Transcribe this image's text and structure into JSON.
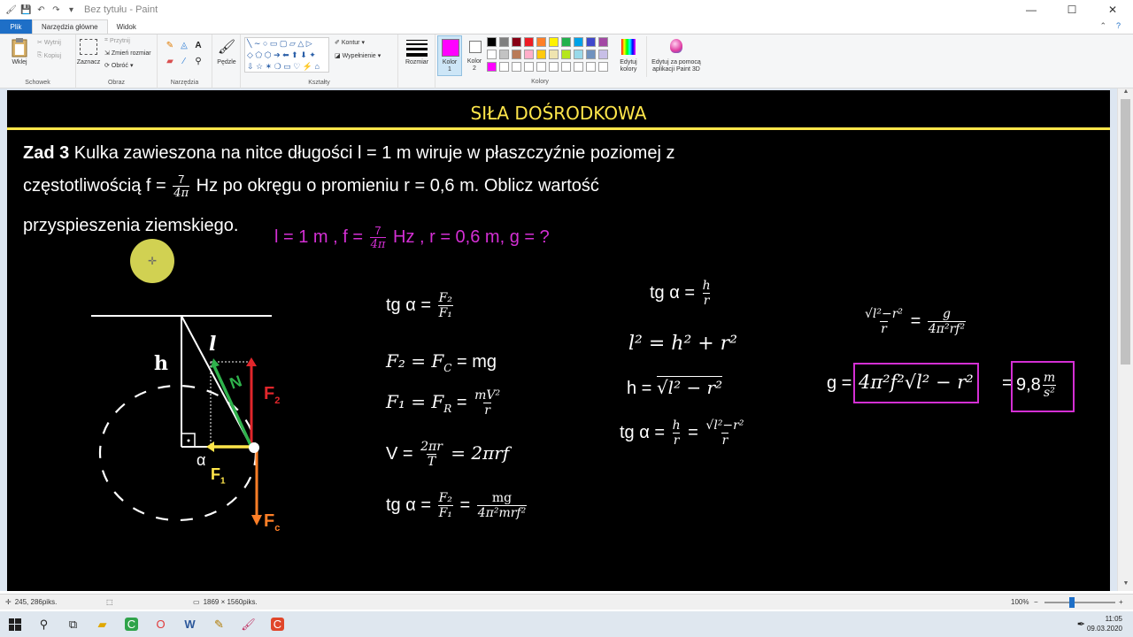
{
  "titlebar": {
    "title": "Bez tytułu - Paint",
    "minimize": "—",
    "maximize": "☐",
    "close": "✕"
  },
  "tabs": {
    "file": "Plik",
    "home": "Narzędzia główne",
    "view": "Widok",
    "help": "?"
  },
  "ribbon": {
    "clipboard": {
      "paste": "Wklej",
      "cut": "Wytnij",
      "copy": "Kopiuj",
      "label": "Schowek"
    },
    "image": {
      "select": "Zaznacz",
      "crop": "Przytnij",
      "resize": "Zmień rozmiar",
      "rotate": "Obróć",
      "label": "Obraz"
    },
    "tools": {
      "label": "Narzędzia"
    },
    "brushes": {
      "label": "Pędzle"
    },
    "shapes": {
      "outline": "Kontur",
      "fill": "Wypełnienie",
      "label": "Kształty"
    },
    "size": {
      "label": "Rozmiar"
    },
    "color1": {
      "label1": "Kolor",
      "label2": "1",
      "value": "#ff00ff"
    },
    "color2": {
      "label1": "Kolor",
      "label2": "2",
      "value": "#ffffff"
    },
    "colors": {
      "label": "Kolory",
      "palette": [
        "#000000",
        "#7f7f7f",
        "#880015",
        "#ed1c24",
        "#ff7f27",
        "#fff200",
        "#22b14c",
        "#00a2e8",
        "#3f48cc",
        "#a349a4",
        "#ffffff",
        "#c3c3c3",
        "#b97a57",
        "#ffaec9",
        "#ffc90e",
        "#efe4b0",
        "#b5e61d",
        "#99d9ea",
        "#7092be",
        "#c8bfe7",
        "#ff00ff",
        "#ffffff",
        "#ffffff",
        "#ffffff",
        "#ffffff",
        "#ffffff",
        "#ffffff",
        "#ffffff",
        "#ffffff",
        "#ffffff"
      ]
    },
    "edit_colors": {
      "line1": "Edytuj",
      "line2": "kolory"
    },
    "paint3d": {
      "line1": "Edytuj za pomocą",
      "line2": "aplikacji Paint 3D"
    }
  },
  "canvas": {
    "heading": "SIŁA DOŚRODKOWA",
    "heading_color": "#ffe64a",
    "task": {
      "label": "Zad 3",
      "line1": " Kulka zawieszona na nitce długości l = 1 m wiruje w płaszczyźnie poziomej z",
      "line2a": "częstotliwością f = ",
      "frac_num": "7",
      "frac_den": "4π",
      "line2b": " Hz po okręgu o promieniu r = 0,6 m. Oblicz wartość",
      "line3": "przyspieszenia ziemskiego."
    },
    "given": {
      "a": "l = 1 m , f = ",
      "frac_num": "7",
      "frac_den": "4π",
      "b": " Hz , r = 0,6 m, g = ?"
    },
    "diagram": {
      "h": "h",
      "l": "l",
      "alpha": "α",
      "N": "N",
      "F2": "F",
      "F2_sub": "2",
      "F1": "F",
      "F1_sub": "1",
      "Fc": "F",
      "Fc_sub": "c"
    },
    "col1": {
      "eq1_a": "tg α = ",
      "eq1_num": "F₂",
      "eq1_den": "F₁",
      "eq2": "F₂ = F",
      "eq2_sub": "C",
      "eq2_b": " = mg",
      "eq3": "F₁ = F",
      "eq3_sub": "R",
      "eq3_b": " = ",
      "eq3_num": "mV²",
      "eq3_den": "r",
      "eq4_a": "V = ",
      "eq4_num": "2πr",
      "eq4_den": "T",
      "eq4_b": " = 2πrf",
      "eq5_a": "tg α = ",
      "eq5_num": "F₂",
      "eq5_den": "F₁",
      "eq5_b": " = ",
      "eq5_num2": "mg",
      "eq5_den2": "4π²mrf²"
    },
    "col2": {
      "eq1_a": "tg α = ",
      "eq1_num": "h",
      "eq1_den": "r",
      "eq2": "l² = h² + r²",
      "eq3_a": "h = ",
      "eq3_b": "√l² − r²",
      "eq4_a": "tg α = ",
      "eq4_num": "h",
      "eq4_den": "r",
      "eq4_b": " = ",
      "eq4_num2": "√l²−r²",
      "eq4_den2": "r"
    },
    "col3": {
      "eq1_num": "√l²−r²",
      "eq1_den": "r",
      "eq1_b": " = ",
      "eq1_num2": "g",
      "eq1_den2": "4π²rf²",
      "eq2_a": "g = ",
      "eq2_box": "4π²f²√l² − r²",
      "eq2_eq": "=",
      "eq2_val": "9,8",
      "eq2_unit_num": "m",
      "eq2_unit_den": "s²"
    }
  },
  "statusbar": {
    "position": "245, 286piks.",
    "size": "1869 × 1560piks.",
    "zoom": "100%"
  },
  "taskbar": {
    "time": "11:05",
    "date": "09.03.2020"
  }
}
